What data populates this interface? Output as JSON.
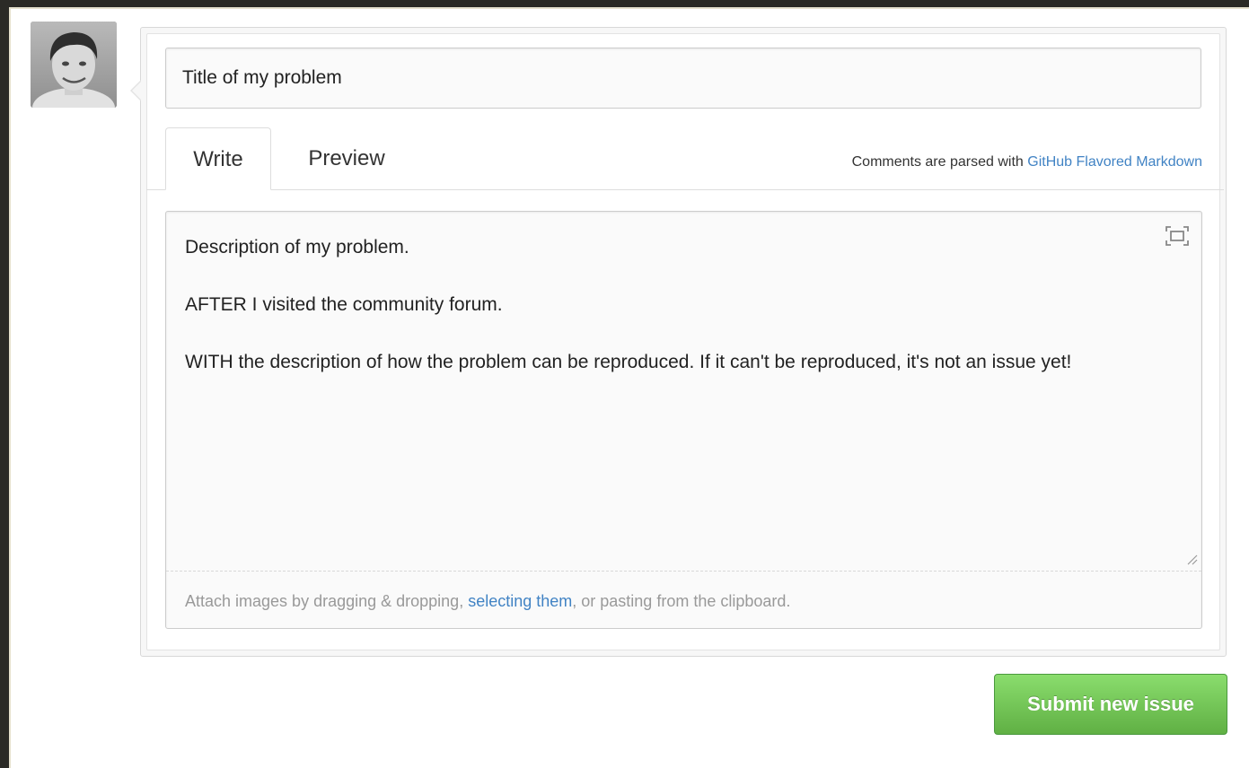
{
  "issue_form": {
    "title_value": "Title of my problem",
    "tabs": [
      {
        "label": "Write",
        "selected": true
      },
      {
        "label": "Preview",
        "selected": false
      }
    ],
    "markdown_note": {
      "prefix": "Comments are parsed with ",
      "link_text": "GitHub Flavored Markdown"
    },
    "body_value": "Description of my problem.\n\nAFTER I visited the community forum.\n\nWITH the description of how the problem can be reproduced. If it can't be reproduced, it's not an issue yet!",
    "attach_note": {
      "prefix": "Attach images by dragging & dropping, ",
      "link_text": "selecting them",
      "suffix": ", or pasting from the clipboard."
    },
    "submit_label": "Submit new issue"
  },
  "icons": {
    "fullscreen": "fullscreen-icon",
    "resize": "resize-grip-icon"
  },
  "colors": {
    "link": "#4183c4",
    "submit_green": "#60b044",
    "muted_text": "#999999"
  }
}
